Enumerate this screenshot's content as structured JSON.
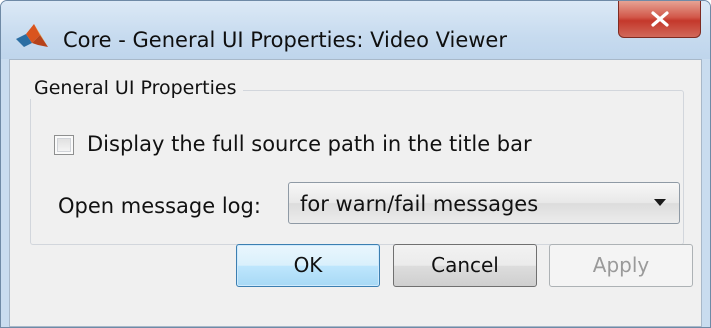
{
  "window": {
    "title": "Core - General UI Properties: Video Viewer",
    "app_icon": "matlab-icon",
    "close_icon": "close-icon"
  },
  "group": {
    "legend": "General UI Properties"
  },
  "options": {
    "full_path_checkbox": {
      "label": "Display the full source path in the title bar",
      "checked": false
    },
    "message_log": {
      "label": "Open message log:",
      "selected": "for warn/fail messages"
    }
  },
  "buttons": {
    "ok": "OK",
    "cancel": "Cancel",
    "apply": "Apply",
    "apply_enabled": false
  },
  "colors": {
    "close_button": "#c4382b",
    "default_button_border": "#3c7fb1",
    "dialog_background": "#f0f0f0"
  }
}
